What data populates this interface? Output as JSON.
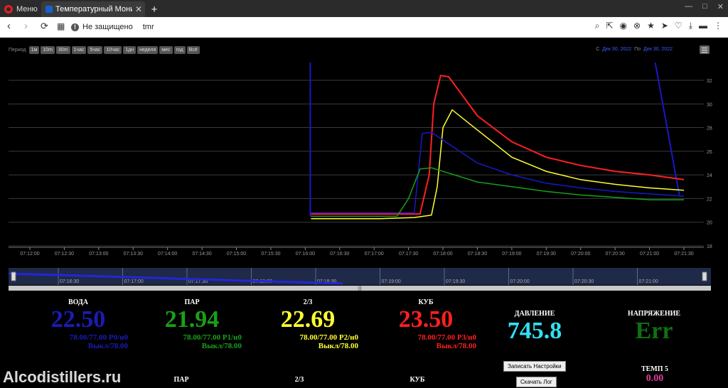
{
  "browser": {
    "menu_label": "Меню",
    "tab_title": "Температурный Монитор",
    "new_tab": "+",
    "back": "‹",
    "forward": "›",
    "reload": "⟳",
    "grid": "▦",
    "security": "Не защищено",
    "url": "tmr",
    "tools": [
      "⌕",
      "⇱",
      "◉",
      "⊗",
      "★",
      "➤",
      "♡",
      "⤓",
      "▬",
      "⋮"
    ],
    "window": [
      "—",
      "□",
      "✕"
    ]
  },
  "period": {
    "label": "Период",
    "buttons": [
      "1м",
      "10m",
      "30m",
      "1час",
      "5час",
      "10час",
      "1дн",
      "неделя",
      "мес",
      "год",
      "Всё"
    ]
  },
  "range": {
    "from_label": "С",
    "from": "Дек 30, 2022",
    "to_label": "По",
    "to": "Дек 30, 2022"
  },
  "chart_data": {
    "type": "line",
    "x_ticks": [
      "07:12:00",
      "07:12:30",
      "07:13:00",
      "07:13:30",
      "07:14:00",
      "07:14:30",
      "07:15:00",
      "07:15:30",
      "07:16:00",
      "07:16:30",
      "07:17:00",
      "07:17:30",
      "07:18:00",
      "07:18:30",
      "07:19:00",
      "07:19:30",
      "07:20:00",
      "07:20:30",
      "07:21:00",
      "07:21:30"
    ],
    "y_ticks": [
      18,
      20,
      22,
      24,
      26,
      28,
      30,
      32
    ],
    "ylim": [
      18,
      33.5
    ],
    "xlim": [
      "07:12:00",
      "07:21:30"
    ],
    "grid": true,
    "series": [
      {
        "color": "#ff2020",
        "points": [
          [
            "07:16:05",
            20.7
          ],
          [
            "07:17:40",
            20.7
          ],
          [
            "07:17:48",
            24
          ],
          [
            "07:17:52",
            30
          ],
          [
            "07:17:58",
            32.4
          ],
          [
            "07:18:05",
            32.3
          ],
          [
            "07:18:30",
            29
          ],
          [
            "07:19:00",
            26.8
          ],
          [
            "07:19:30",
            25.5
          ],
          [
            "07:20:00",
            24.8
          ],
          [
            "07:20:30",
            24.3
          ],
          [
            "07:21:00",
            24.0
          ],
          [
            "07:21:30",
            23.6
          ]
        ]
      },
      {
        "color": "#ffff30",
        "points": [
          [
            "07:16:05",
            20.3
          ],
          [
            "07:17:05",
            20.3
          ],
          [
            "07:17:35",
            20.4
          ],
          [
            "07:17:50",
            20.6
          ],
          [
            "07:17:55",
            23
          ],
          [
            "07:18:00",
            28
          ],
          [
            "07:18:08",
            29.5
          ],
          [
            "07:18:30",
            27.8
          ],
          [
            "07:19:00",
            25.5
          ],
          [
            "07:19:30",
            24.3
          ],
          [
            "07:20:00",
            23.6
          ],
          [
            "07:20:30",
            23.2
          ],
          [
            "07:21:00",
            22.9
          ],
          [
            "07:21:30",
            22.7
          ]
        ]
      },
      {
        "color": "#1818c8",
        "points": [
          [
            "07:16:05",
            20.8
          ],
          [
            "07:17:35",
            20.8
          ],
          [
            "07:17:42",
            27.5
          ],
          [
            "07:17:50",
            27.6
          ],
          [
            "07:18:30",
            25.0
          ],
          [
            "07:19:00",
            24.0
          ],
          [
            "07:19:30",
            23.3
          ],
          [
            "07:20:00",
            22.9
          ],
          [
            "07:20:30",
            22.6
          ],
          [
            "07:21:00",
            22.4
          ],
          [
            "07:21:30",
            22.2
          ]
        ]
      },
      {
        "color": "#18a018",
        "points": [
          [
            "07:16:05",
            20.5
          ],
          [
            "07:17:20",
            20.5
          ],
          [
            "07:17:30",
            22
          ],
          [
            "07:17:40",
            24.5
          ],
          [
            "07:17:50",
            24.6
          ],
          [
            "07:18:30",
            23.4
          ],
          [
            "07:19:00",
            23.0
          ],
          [
            "07:19:30",
            22.6
          ],
          [
            "07:20:00",
            22.3
          ],
          [
            "07:20:30",
            22.1
          ],
          [
            "07:21:00",
            21.9
          ],
          [
            "07:21:30",
            21.9
          ]
        ]
      }
    ],
    "navigator_ticks": [
      "07:16:30",
      "07:17:00",
      "07:17:30",
      "07:18:00",
      "07:18:30",
      "07:19:00",
      "07:19:30",
      "07:20:00",
      "07:20:30",
      "07:21:00"
    ]
  },
  "readouts": [
    {
      "name": "ВОДА",
      "value": "22.50",
      "line1": "78.00/77.00 P0/н0",
      "line2": "Выкл/78.00",
      "color": "#1b1bb8",
      "sub_color": "#1b1bb8"
    },
    {
      "name": "ПАР",
      "value": "21.94",
      "line1": "78.00/77.00 P1/н0",
      "line2": "Выкл/78.00",
      "color": "#18a018",
      "sub_color": "#18a018"
    },
    {
      "name": "2/3",
      "value": "22.69",
      "line1": "78.00/77.00 P2/н0",
      "line2": "Выкл/78.00",
      "color": "#ffff30",
      "sub_color": "#ffff30"
    },
    {
      "name": "КУБ",
      "value": "23.50",
      "line1": "78.00/77.00 P3/н0",
      "line2": "Выкл/78.00",
      "color": "#ff2020",
      "sub_color": "#ff2020"
    }
  ],
  "pressure": {
    "name": "ДАВЛЕНИЕ",
    "value": "745.8",
    "color": "#30e0f0"
  },
  "voltage": {
    "name": "НАПРЯЖЕНИЕ",
    "value": "Err",
    "color": "#107010"
  },
  "temp5": {
    "name": "ТЕМП 5",
    "value": "0.00",
    "color": "#e040a0"
  },
  "bottom_labels": [
    "ПАР",
    "2/3",
    "КУБ"
  ],
  "buttons": {
    "save": "Записать Настройки",
    "log": "Скачать Лог"
  },
  "watermark": "Alcodistillers.ru"
}
